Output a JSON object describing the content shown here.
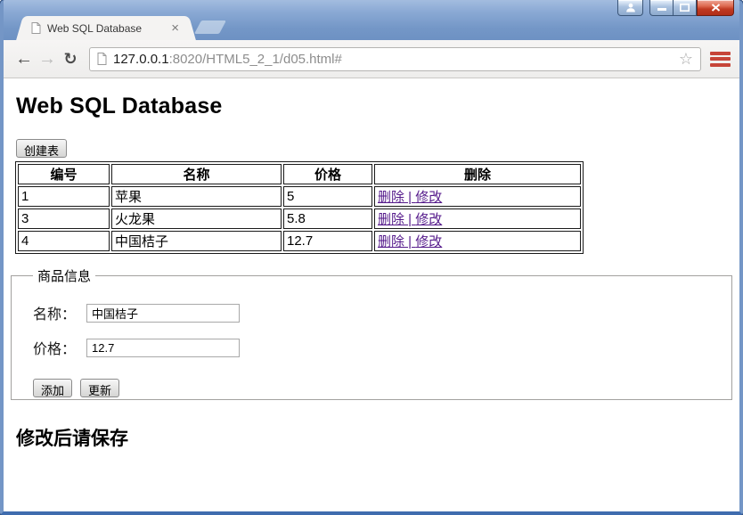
{
  "window_controls": {
    "avatar_icon": "person-silhouette",
    "minimize_icon": "minimize-bar",
    "maximize_icon": "maximize-square",
    "close_icon": "close-x"
  },
  "tab": {
    "title": "Web SQL Database",
    "close_glyph": "×"
  },
  "toolbar": {
    "back_glyph": "←",
    "forward_glyph": "→",
    "refresh_glyph": "↻",
    "url_host": "127.0.0.1",
    "url_rest": ":8020/HTML5_2_1/d05.html#",
    "star_glyph": "☆"
  },
  "content": {
    "heading": "Web SQL Database",
    "create_table_button": "创建表",
    "table": {
      "headers": [
        "编号",
        "名称",
        "价格",
        "删除"
      ],
      "action_separator": " | ",
      "rows": [
        {
          "id": "1",
          "name": "苹果",
          "price": "5",
          "action_delete": "删除",
          "action_edit": "修改"
        },
        {
          "id": "3",
          "name": "火龙果",
          "price": "5.8",
          "action_delete": "删除",
          "action_edit": "修改"
        },
        {
          "id": "4",
          "name": "中国桔子",
          "price": "12.7",
          "action_delete": "删除",
          "action_edit": "修改"
        }
      ]
    },
    "form": {
      "legend": "商品信息",
      "name_label": "名称：",
      "name_value": "中国桔子",
      "price_label": "价格：",
      "price_value": "12.7",
      "add_button": "添加",
      "update_button": "更新"
    },
    "save_note": "修改后请保存"
  },
  "colors": {
    "titlebar_blue": "#7497c7",
    "toolbar_gray": "#f4f3f2",
    "menu_badge_red": "#c64539",
    "visited_link_purple": "#551a8b"
  }
}
